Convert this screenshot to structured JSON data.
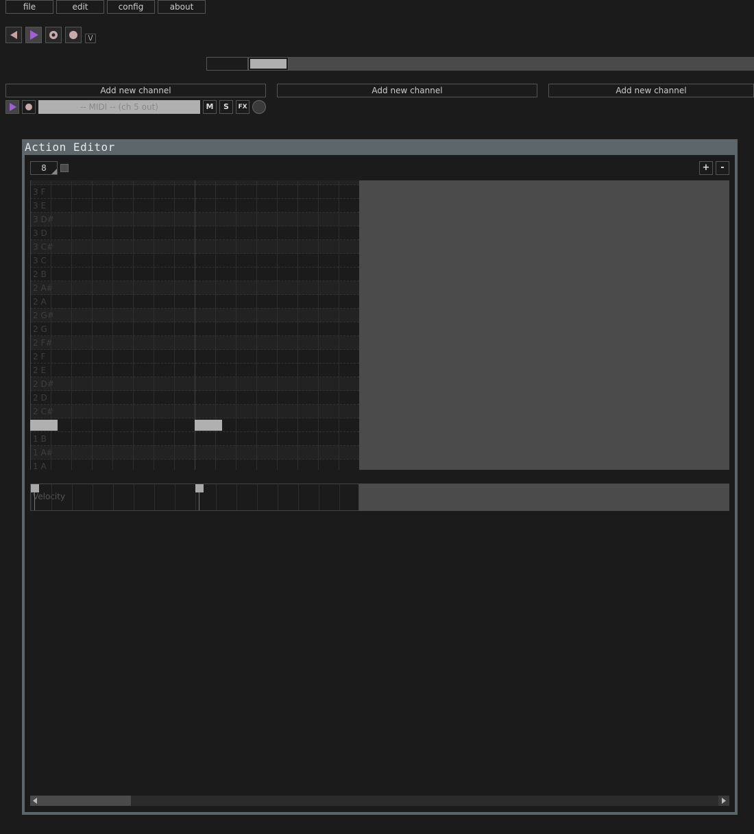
{
  "menu": {
    "file": "file",
    "edit": "edit",
    "config": "config",
    "about": "about"
  },
  "transport": {
    "input_mode_label": "\\/"
  },
  "channels": {
    "add_label_1": "Add new channel",
    "add_label_2": "Add new channel",
    "add_label_3": "Add new channel",
    "midi_channel_name": "-- MIDI -- (ch 5 out)",
    "mute": "M",
    "solo": "S",
    "fx": "FX"
  },
  "action_editor": {
    "title": "Action Editor",
    "grid_value": "8",
    "zoom_in": "+",
    "zoom_out": "-",
    "velocity_label": "Velocity",
    "piano_rows": [
      {
        "label": "3 F",
        "sharp": false
      },
      {
        "label": "3 E",
        "sharp": false
      },
      {
        "label": "3 D#",
        "sharp": true
      },
      {
        "label": "3 D",
        "sharp": false
      },
      {
        "label": "3 C#",
        "sharp": true
      },
      {
        "label": "3 C",
        "sharp": false
      },
      {
        "label": "2 B",
        "sharp": false
      },
      {
        "label": "2 A#",
        "sharp": true
      },
      {
        "label": "2 A",
        "sharp": false
      },
      {
        "label": "2 G#",
        "sharp": true
      },
      {
        "label": "2 G",
        "sharp": false
      },
      {
        "label": "2 F#",
        "sharp": true
      },
      {
        "label": "2 F",
        "sharp": false
      },
      {
        "label": "2 E",
        "sharp": false
      },
      {
        "label": "2 D#",
        "sharp": true
      },
      {
        "label": "2 D",
        "sharp": false
      },
      {
        "label": "2 C#",
        "sharp": true
      },
      {
        "label": "2 C",
        "sharp": false
      },
      {
        "label": "1 B",
        "sharp": false
      },
      {
        "label": "1 A#",
        "sharp": true
      },
      {
        "label": "1 A",
        "sharp": false
      }
    ],
    "colors": {
      "note": "#b0b0b0",
      "accent": "#9b4fc2",
      "panel": "#4b4b4b"
    }
  }
}
